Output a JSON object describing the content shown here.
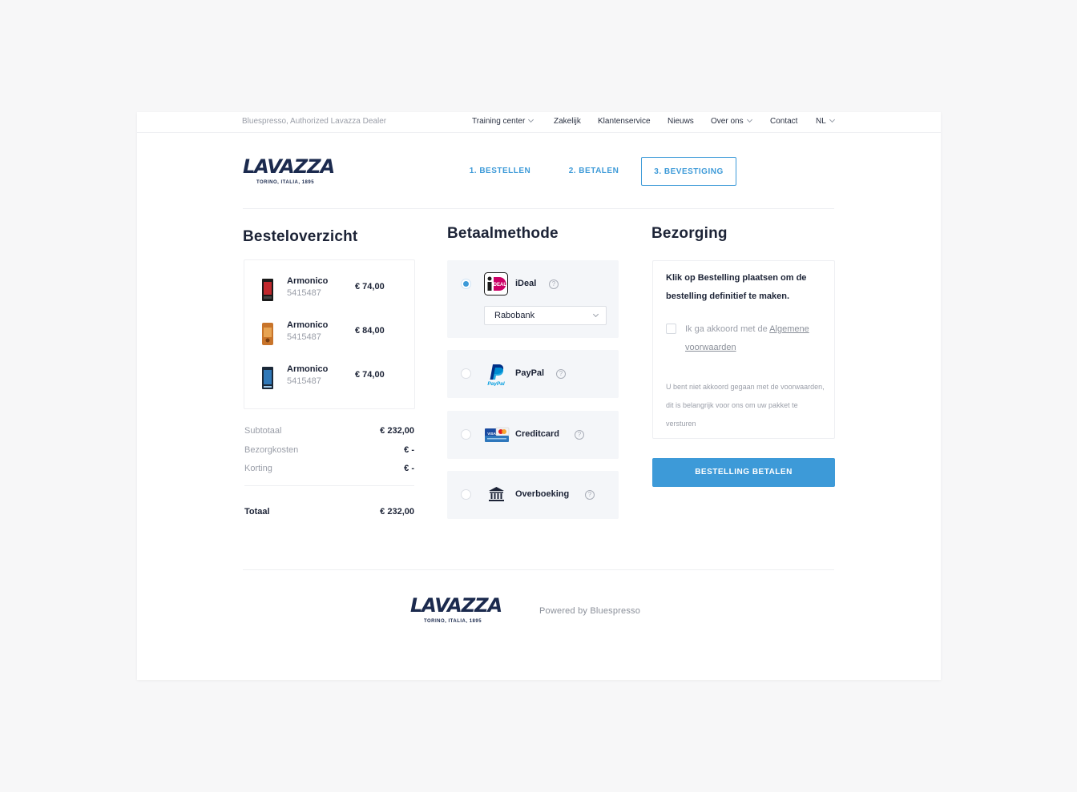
{
  "topbar": {
    "tagline": "Bluespresso, Authorized Lavazza Dealer",
    "nav": [
      {
        "label": "Training center",
        "dropdown": true
      },
      {
        "label": "Zakelijk",
        "dropdown": false
      },
      {
        "label": "Klantenservice",
        "dropdown": false
      },
      {
        "label": "Nieuws",
        "dropdown": false
      },
      {
        "label": "Over ons",
        "dropdown": true
      },
      {
        "label": "Contact",
        "dropdown": false
      },
      {
        "label": "NL",
        "dropdown": true
      }
    ]
  },
  "logo": {
    "word": "LAVAZZA",
    "sub": "TORINO, ITALIA, 1895"
  },
  "steps": [
    {
      "label": "1. BESTELLEN",
      "active": false
    },
    {
      "label": "2. BETALEN",
      "active": false
    },
    {
      "label": "3. BEVESTIGING",
      "active": true
    }
  ],
  "order": {
    "title": "Besteloverzicht",
    "items": [
      {
        "name": "Armonico",
        "sku": "5415487",
        "price": "€ 74,00",
        "color": "#c0282d"
      },
      {
        "name": "Armonico",
        "sku": "5415487",
        "price": "€ 84,00",
        "color": "#d9822b"
      },
      {
        "name": "Armonico",
        "sku": "5415487",
        "price": "€ 74,00",
        "color": "#2f78b8"
      }
    ],
    "subtotal_label": "Subtotaal",
    "subtotal": "€ 232,00",
    "shipping_label": "Bezorgkosten",
    "shipping": "€ -",
    "discount_label": "Korting",
    "discount": "€ -",
    "total_label": "Totaal",
    "total": "€ 232,00"
  },
  "payment": {
    "title": "Betaalmethode",
    "methods": [
      {
        "label": "iDeal",
        "icon": "ideal-icon",
        "selected": true
      },
      {
        "label": "PayPal",
        "icon": "paypal-icon",
        "selected": false
      },
      {
        "label": "Creditcard",
        "icon": "creditcard-icon",
        "selected": false
      },
      {
        "label": "Overboeking",
        "icon": "bank-icon",
        "selected": false
      }
    ],
    "bank_select": "Rabobank",
    "help_glyph": "?"
  },
  "delivery": {
    "title": "Bezorging",
    "message": "Klik op Bestelling plaatsen om de bestelling definitief te maken.",
    "agree_prefix": "Ik ga akkoord met de ",
    "agree_link": "Algemene voorwaarden",
    "warning": "U bent niet akkoord gegaan met de voorwaarden, dit is belangrijk voor ons om uw pakket te versturen",
    "button": "BESTELLING BETALEN"
  },
  "footer": {
    "powered": "Powered by Bluespresso"
  },
  "colors": {
    "accent": "#3d9ad8",
    "navy": "#1b2a4e",
    "ideal": "#cc0066",
    "paypal": "#003087"
  }
}
